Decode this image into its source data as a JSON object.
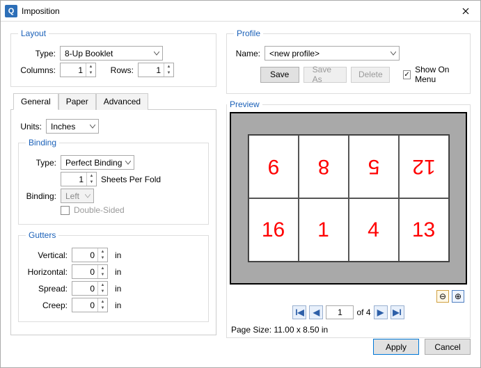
{
  "window": {
    "title": "Imposition"
  },
  "layout": {
    "legend": "Layout",
    "type_label": "Type:",
    "type_value": "8-Up Booklet",
    "columns_label": "Columns:",
    "columns_value": "1",
    "rows_label": "Rows:",
    "rows_value": "1"
  },
  "tabs": [
    "General",
    "Paper",
    "Advanced"
  ],
  "general": {
    "units_label": "Units:",
    "units_value": "Inches"
  },
  "binding": {
    "legend": "Binding",
    "type_label": "Type:",
    "type_value": "Perfect Binding",
    "sheets_per_fold_value": "1",
    "sheets_per_fold_label": "Sheets Per Fold",
    "side_label": "Binding:",
    "side_value": "Left",
    "double_sided_label": "Double-Sided"
  },
  "gutters": {
    "legend": "Gutters",
    "vertical_label": "Vertical:",
    "vertical_value": "0",
    "horizontal_label": "Horizontal:",
    "horizontal_value": "0",
    "spread_label": "Spread:",
    "spread_value": "0",
    "creep_label": "Creep:",
    "creep_value": "0",
    "unit": "in"
  },
  "profile": {
    "legend": "Profile",
    "name_label": "Name:",
    "name_value": "<new profile>",
    "save": "Save",
    "save_as": "Save As",
    "delete": "Delete",
    "show_on_menu": "Show On Menu"
  },
  "preview": {
    "legend": "Preview",
    "pages": [
      "9",
      "8",
      "5",
      "12",
      "16",
      "1",
      "4",
      "13"
    ],
    "current_page": "1",
    "of_text": "of 4",
    "page_size": "Page Size:  11.00 x 8.50 in"
  },
  "footer": {
    "apply": "Apply",
    "cancel": "Cancel"
  }
}
